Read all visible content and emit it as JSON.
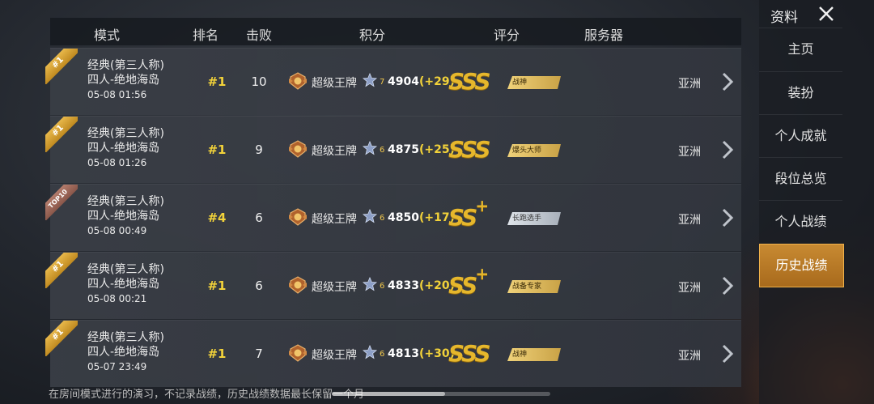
{
  "header": {
    "mode": "模式",
    "rank": "排名",
    "kills": "击败",
    "points": "积分",
    "rating": "评分",
    "server": "服务器"
  },
  "rows": [
    {
      "ribbon": "#1",
      "mode_line1": "经典(第三人称)",
      "mode_line2": "四人-绝地海岛",
      "time": "05-08 01:56",
      "rank": "#1",
      "kills": "10",
      "tier": "超级王牌",
      "stars": "7",
      "points": "4904",
      "delta": "(+29)",
      "grade": "SSS",
      "grade_plus": "",
      "title": "战神",
      "title_style": "gold",
      "server": "亚洲"
    },
    {
      "ribbon": "#1",
      "mode_line1": "经典(第三人称)",
      "mode_line2": "四人-绝地海岛",
      "time": "05-08 01:26",
      "rank": "#1",
      "kills": "9",
      "tier": "超级王牌",
      "stars": "6",
      "points": "4875",
      "delta": "(+25)",
      "grade": "SSS",
      "grade_plus": "",
      "title": "爆头大师",
      "title_style": "gold",
      "server": "亚洲"
    },
    {
      "ribbon": "TOP10",
      "mode_line1": "经典(第三人称)",
      "mode_line2": "四人-绝地海岛",
      "time": "05-08 00:49",
      "rank": "#4",
      "kills": "6",
      "tier": "超级王牌",
      "stars": "6",
      "points": "4850",
      "delta": "(+17)",
      "grade": "SS",
      "grade_plus": "+",
      "title": "长跑选手",
      "title_style": "silver",
      "server": "亚洲"
    },
    {
      "ribbon": "#1",
      "mode_line1": "经典(第三人称)",
      "mode_line2": "四人-绝地海岛",
      "time": "05-08 00:21",
      "rank": "#1",
      "kills": "6",
      "tier": "超级王牌",
      "stars": "6",
      "points": "4833",
      "delta": "(+20)",
      "grade": "SS",
      "grade_plus": "+",
      "title": "战备专家",
      "title_style": "gold",
      "server": "亚洲"
    },
    {
      "ribbon": "#1",
      "mode_line1": "经典(第三人称)",
      "mode_line2": "四人-绝地海岛",
      "time": "05-07 23:49",
      "rank": "#1",
      "kills": "7",
      "tier": "超级王牌",
      "stars": "6",
      "points": "4813",
      "delta": "(+30)",
      "grade": "SSS",
      "grade_plus": "",
      "title": "战神",
      "title_style": "gold",
      "server": "亚洲"
    }
  ],
  "footer": {
    "note": "在房间模式进行的演习，不记录战绩，历史战绩数据最长保留一个月"
  },
  "panel": {
    "title": "资料",
    "close_icon": "close-icon",
    "items": [
      {
        "label": "主页",
        "active": false
      },
      {
        "label": "装扮",
        "active": false
      },
      {
        "label": "个人成就",
        "active": false
      },
      {
        "label": "段位总览",
        "active": false
      },
      {
        "label": "个人战绩",
        "active": false
      },
      {
        "label": "历史战绩",
        "active": true
      }
    ]
  },
  "colors": {
    "accent_gold": "#f2d23a",
    "active_tab": "#c88a32"
  }
}
